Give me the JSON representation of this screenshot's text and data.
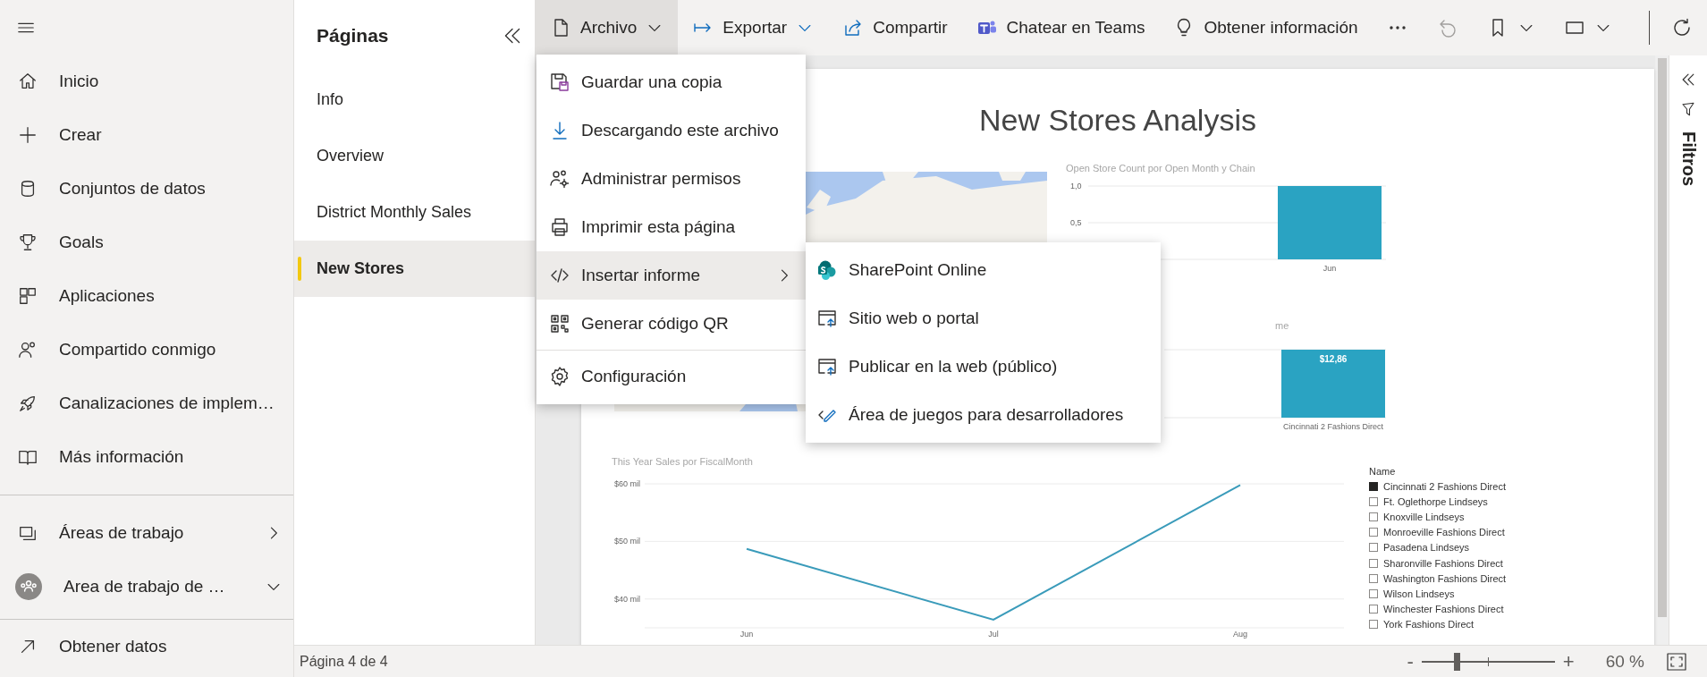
{
  "nav": {
    "items": [
      {
        "label": "Inicio"
      },
      {
        "label": "Crear"
      },
      {
        "label": "Conjuntos de datos"
      },
      {
        "label": "Goals"
      },
      {
        "label": "Aplicaciones"
      },
      {
        "label": "Compartido conmigo"
      },
      {
        "label": "Canalizaciones de implem…"
      },
      {
        "label": "Más información"
      }
    ],
    "workspaces": [
      {
        "label": "Áreas de trabajo",
        "expanded": false
      },
      {
        "label": "Area de trabajo de …",
        "expanded": true
      }
    ],
    "footer": [
      {
        "label": "Obtener datos"
      }
    ]
  },
  "pages": {
    "title": "Páginas",
    "items": [
      {
        "label": "Info",
        "selected": false
      },
      {
        "label": "Overview",
        "selected": false
      },
      {
        "label": "District Monthly Sales",
        "selected": false
      },
      {
        "label": "New Stores",
        "selected": true
      }
    ]
  },
  "toolbar": {
    "items": [
      {
        "kind": "menu",
        "label": "Archivo",
        "selected": true,
        "disabled": false
      },
      {
        "kind": "menu",
        "label": "Exportar",
        "selected": false,
        "disabled": false
      },
      {
        "kind": "button",
        "label": "Compartir",
        "selected": false,
        "disabled": false
      },
      {
        "kind": "button",
        "label": "Chatear en Teams",
        "selected": false,
        "disabled": false
      },
      {
        "kind": "button",
        "label": "Obtener información",
        "selected": false,
        "disabled": false
      },
      {
        "kind": "icon",
        "selected": false,
        "disabled": false
      },
      {
        "kind": "icon",
        "selected": false,
        "disabled": true
      },
      {
        "kind": "icon-menu",
        "selected": false,
        "disabled": false
      },
      {
        "kind": "icon-menu",
        "selected": false,
        "disabled": false
      },
      {
        "kind": "icon",
        "selected": false,
        "disabled": false
      }
    ]
  },
  "file_menu": {
    "items": [
      {
        "kind": "item",
        "label": "Guardar una copia",
        "selected": false,
        "submenu": false
      },
      {
        "kind": "item",
        "label": "Descargando este archivo",
        "selected": false,
        "submenu": false
      },
      {
        "kind": "item",
        "label": "Administrar permisos",
        "selected": false,
        "submenu": false
      },
      {
        "kind": "item",
        "label": "Imprimir esta página",
        "selected": false,
        "submenu": false
      },
      {
        "kind": "item",
        "label": "Insertar informe",
        "selected": true,
        "submenu": true
      },
      {
        "kind": "item",
        "label": "Generar código QR",
        "selected": false,
        "submenu": false
      },
      {
        "kind": "separator"
      },
      {
        "kind": "item",
        "label": "Configuración",
        "selected": false,
        "submenu": false
      }
    ]
  },
  "embed_menu": {
    "items": [
      {
        "label": "SharePoint Online"
      },
      {
        "label": "Sitio web o portal"
      },
      {
        "label": "Publicar en la web (público)"
      },
      {
        "label": "Área de juegos para desarrolladores"
      }
    ]
  },
  "report": {
    "title": "New Stores Analysis",
    "visuals": [
      {
        "kind": "picture"
      },
      {
        "kind": "chart",
        "chart_data": {
          "type": "bar",
          "title": "Open Store Count por Open Month y Chain",
          "categories": [
            "Jun"
          ],
          "values": [
            1.0
          ],
          "ylim": [
            0,
            1
          ],
          "yticks": [
            {
              "value": 1,
              "label": "1,0"
            },
            {
              "value": 0.5,
              "label": "0,5"
            }
          ]
        }
      },
      {
        "kind": "single-bar",
        "title": "me",
        "category": "Cincinnati 2 Fashions Direct",
        "value_label": "$12,86"
      },
      {
        "kind": "chart",
        "chart_data": {
          "type": "line",
          "title": "This Year Sales por FiscalMonth",
          "categories": [
            "Jun",
            "Jul",
            "Aug"
          ],
          "values": [
            48.7,
            36.4,
            59.8
          ],
          "ylim": [
            35,
            60
          ],
          "yticks": [
            {
              "value": 40,
              "label": "$40 mil"
            },
            {
              "value": 50,
              "label": "$50 mil"
            },
            {
              "value": 60,
              "label": "$60 mil"
            }
          ]
        }
      },
      {
        "kind": "slicer",
        "title": "Name",
        "items": [
          {
            "label": "Cincinnati 2 Fashions Direct",
            "checked": true
          },
          {
            "label": "Ft. Oglethorpe Lindseys",
            "checked": false
          },
          {
            "label": "Knoxville Lindseys",
            "checked": false
          },
          {
            "label": "Monroeville Fashions Direct",
            "checked": false
          },
          {
            "label": "Pasadena Lindseys",
            "checked": false
          },
          {
            "label": "Sharonville Fashions Direct",
            "checked": false
          },
          {
            "label": "Washington Fashions Direct",
            "checked": false
          },
          {
            "label": "Wilson Lindseys",
            "checked": false
          },
          {
            "label": "Winchester Fashions Direct",
            "checked": false
          },
          {
            "label": "York Fashions Direct",
            "checked": false
          }
        ]
      }
    ]
  },
  "filters": {
    "label": "Filtros"
  },
  "status_bar": {
    "page_label": "Página 4 de 4",
    "zoom": {
      "minus": "-",
      "plus": "+",
      "level": 0.26,
      "reading": "60 %"
    }
  }
}
